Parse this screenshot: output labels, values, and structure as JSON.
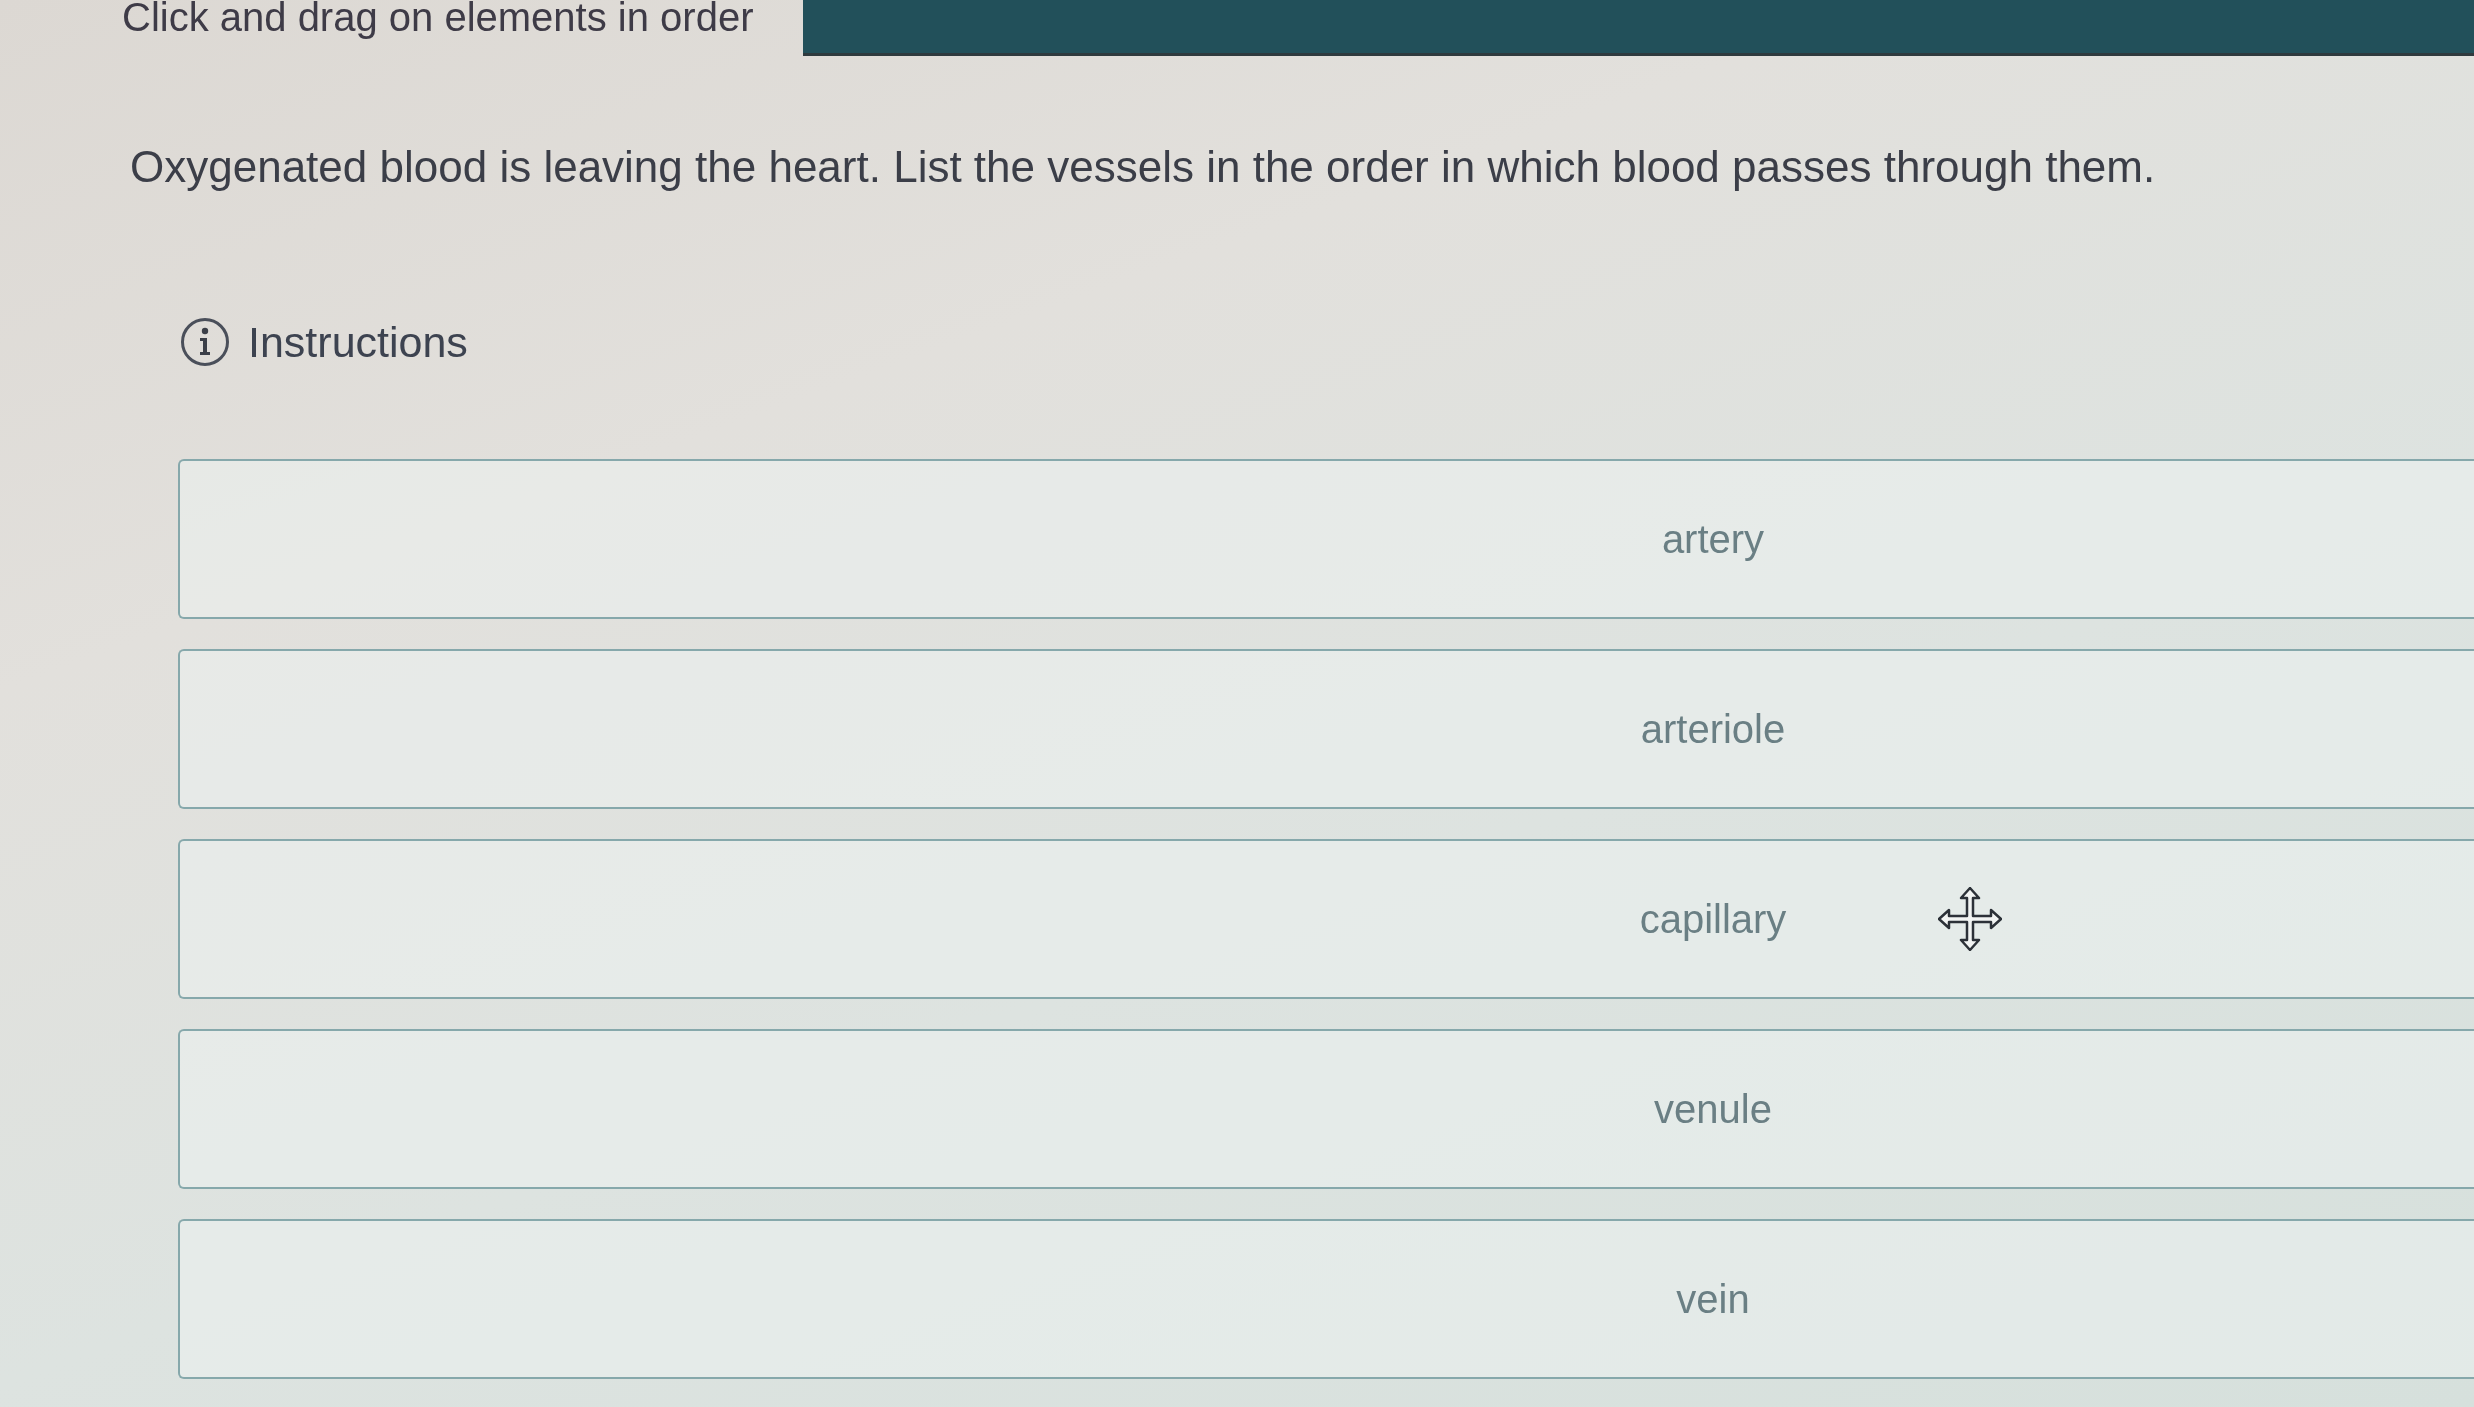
{
  "header": {
    "text": "Click and drag on elements in order"
  },
  "question": {
    "text": "Oxygenated blood is leaving the heart. List the vessels in the order in which blood passes through them."
  },
  "instructions": {
    "label": "Instructions"
  },
  "items": [
    {
      "label": "artery",
      "hovered": false
    },
    {
      "label": "arteriole",
      "hovered": false
    },
    {
      "label": "capillary",
      "hovered": true
    },
    {
      "label": "venule",
      "hovered": false
    },
    {
      "label": "vein",
      "hovered": false
    }
  ]
}
